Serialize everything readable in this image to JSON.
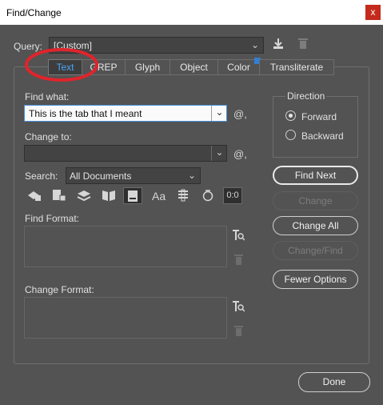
{
  "window": {
    "title": "Find/Change",
    "close": "x"
  },
  "query": {
    "label": "Query:",
    "value": "[Custom]"
  },
  "tabs": [
    {
      "label": "Text"
    },
    {
      "label": "GREP"
    },
    {
      "label": "Glyph"
    },
    {
      "label": "Object"
    },
    {
      "label": "Color"
    },
    {
      "label": "Transliterate"
    }
  ],
  "find_what": {
    "label": "Find what:",
    "value": "This is the tab that I meant"
  },
  "change_to": {
    "label": "Change to:",
    "value": ""
  },
  "search": {
    "label": "Search:",
    "value": "All Documents"
  },
  "find_format": {
    "label": "Find Format:"
  },
  "change_format": {
    "label": "Change Format:"
  },
  "direction": {
    "label": "Direction",
    "forward": "Forward",
    "backward": "Backward",
    "selected": "Forward"
  },
  "buttons": {
    "find_next": "Find Next",
    "change": "Change",
    "change_all": "Change All",
    "change_find": "Change/Find",
    "fewer_options": "Fewer Options",
    "done": "Done"
  },
  "icons": {
    "special_char": "@,",
    "case_sensitive": "Aa"
  },
  "colors": {
    "accent": "#4aa3f5",
    "annotation": "#e0242b",
    "background": "#535353"
  }
}
